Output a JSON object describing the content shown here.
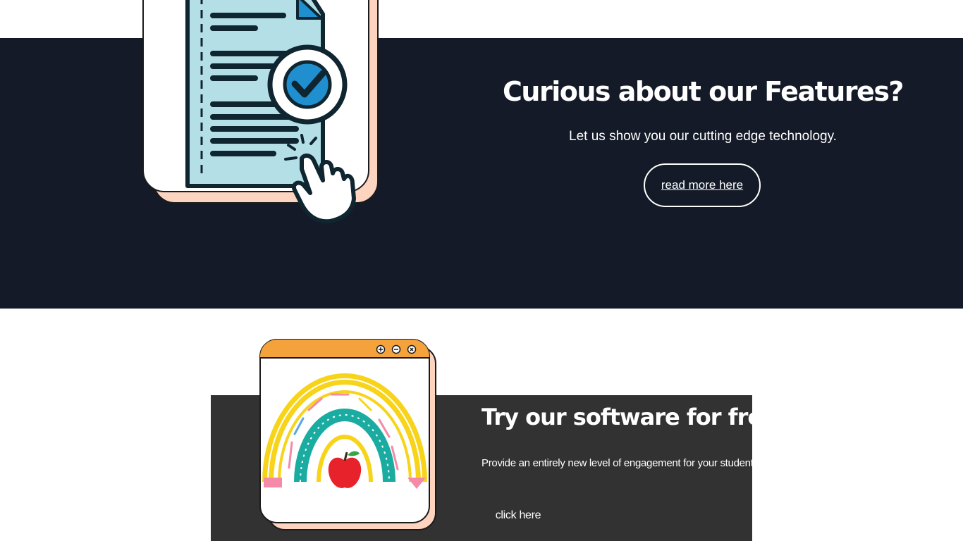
{
  "features": {
    "title": "Curious about our Features?",
    "subtitle": "Let us show you our cutting edge technology.",
    "button_label": "read more here",
    "illustration": "document-checkmark-click-icon"
  },
  "trial": {
    "title": "Try our software for free",
    "subtitle": "Provide an entirely new level of engagement for your students",
    "button_label": "click here",
    "illustration": "rainbow-apple-window-icon",
    "window_controls": [
      "zoom-in-icon",
      "minimize-icon",
      "close-icon"
    ]
  },
  "colors": {
    "dark_band": "#141a27",
    "gray_panel": "#323232",
    "window_titlebar": "#f4a23c",
    "card_shadow": "#fdd4bf",
    "document_fill": "#b5dfe6"
  }
}
